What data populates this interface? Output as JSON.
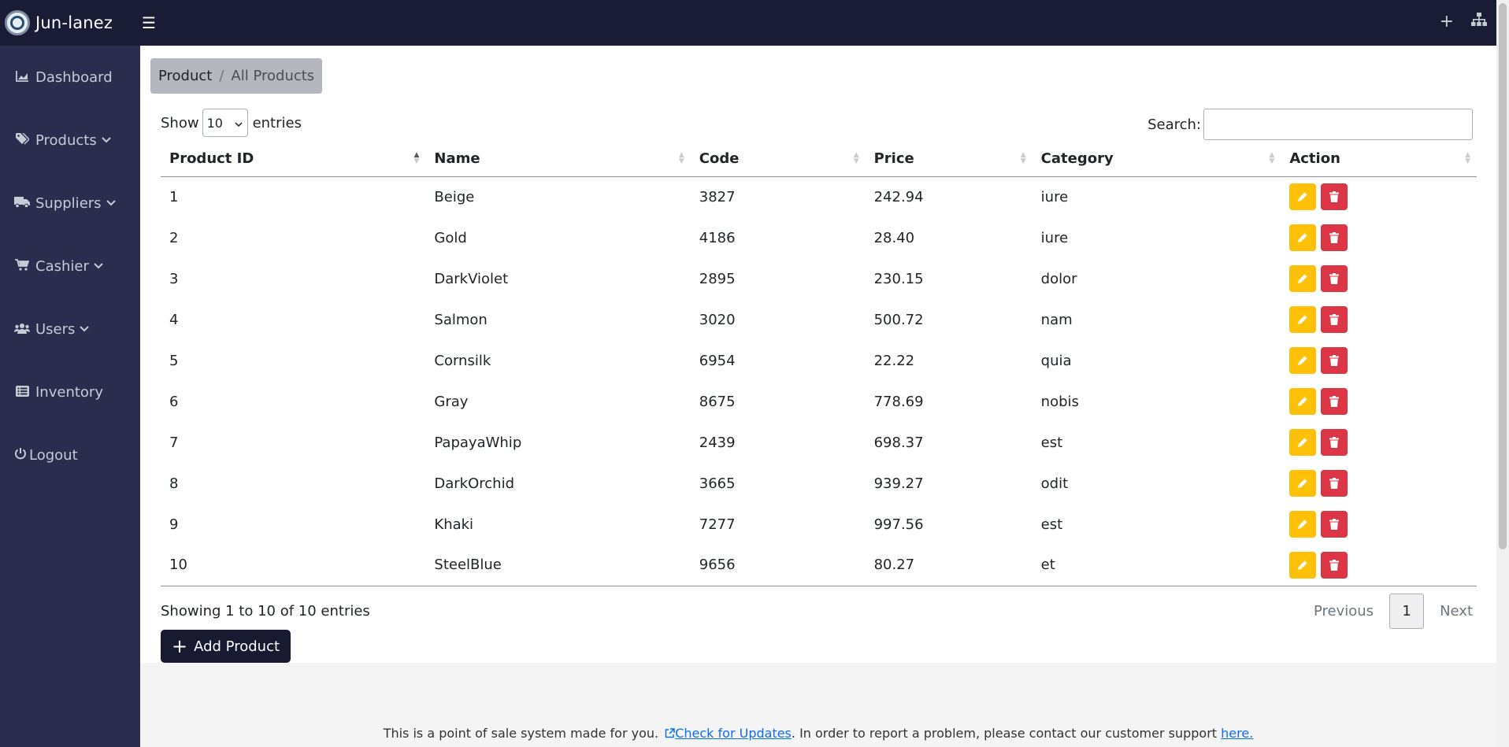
{
  "app": {
    "name": "Jun-lanez"
  },
  "sidebar": {
    "items": [
      {
        "label": "Dashboard",
        "icon": "chart-area-icon"
      },
      {
        "label": "Products",
        "icon": "tags-icon"
      },
      {
        "label": "Suppliers",
        "icon": "truck-icon"
      },
      {
        "label": "Cashier",
        "icon": "cart-icon"
      },
      {
        "label": "Users",
        "icon": "users-icon"
      },
      {
        "label": "Inventory",
        "icon": "list-icon"
      },
      {
        "label": "Logout",
        "icon": "power-icon"
      }
    ]
  },
  "breadcrumb": {
    "section": "Product",
    "separator": "/",
    "current": "All Products"
  },
  "table_controls": {
    "show_label": "Show",
    "entries_value": "10",
    "entries_label": "entries",
    "search_label": "Search:",
    "search_value": ""
  },
  "table": {
    "columns": [
      "Product ID",
      "Name",
      "Code",
      "Price",
      "Category",
      "Action"
    ],
    "rows": [
      {
        "id": "1",
        "name": "Beige",
        "code": "3827",
        "price": "242.94",
        "category": "iure"
      },
      {
        "id": "2",
        "name": "Gold",
        "code": "4186",
        "price": "28.40",
        "category": "iure"
      },
      {
        "id": "3",
        "name": "DarkViolet",
        "code": "2895",
        "price": "230.15",
        "category": "dolor"
      },
      {
        "id": "4",
        "name": "Salmon",
        "code": "3020",
        "price": "500.72",
        "category": "nam"
      },
      {
        "id": "5",
        "name": "Cornsilk",
        "code": "6954",
        "price": "22.22",
        "category": "quia"
      },
      {
        "id": "6",
        "name": "Gray",
        "code": "8675",
        "price": "778.69",
        "category": "nobis"
      },
      {
        "id": "7",
        "name": "PapayaWhip",
        "code": "2439",
        "price": "698.37",
        "category": "est"
      },
      {
        "id": "8",
        "name": "DarkOrchid",
        "code": "3665",
        "price": "939.27",
        "category": "odit"
      },
      {
        "id": "9",
        "name": "Khaki",
        "code": "7277",
        "price": "997.56",
        "category": "est"
      },
      {
        "id": "10",
        "name": "SteelBlue",
        "code": "9656",
        "price": "80.27",
        "category": "et"
      }
    ]
  },
  "pagination": {
    "info": "Showing 1 to 10 of 10 entries",
    "previous": "Previous",
    "current_page": "1",
    "next": "Next"
  },
  "add_button": {
    "label": "Add Product"
  },
  "footer": {
    "text_before": "This is a point of sale system made for you.",
    "update_link": "Check for Updates",
    "text_middle": ". In order to report a problem, please contact our customer support",
    "support_link": "here."
  },
  "colors": {
    "topbar": "#1a1c36",
    "sidebar": "#2c2c4e",
    "edit_button": "#ffc107",
    "delete_button": "#dc3545",
    "primary_button": "#171a30",
    "link": "#0d6efd"
  }
}
